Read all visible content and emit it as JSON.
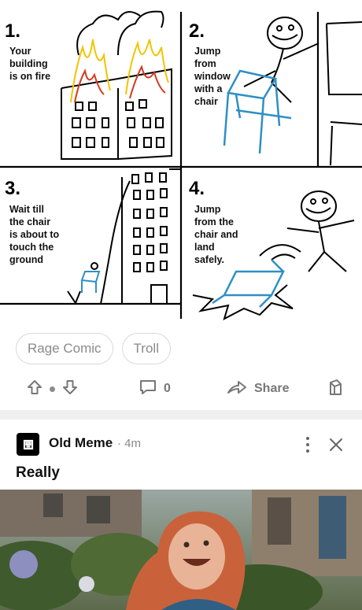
{
  "comic": {
    "panels": [
      {
        "number": "1.",
        "text": "Your\nbuilding\nis on fire"
      },
      {
        "number": "2.",
        "text": "Jump\nfrom\nwindow\nwith a\nchair"
      },
      {
        "number": "3.",
        "text": "Wait till\nthe chair\nis about to\ntouch the\nground"
      },
      {
        "number": "4.",
        "text": "Jump\nfrom the\nchair and\nland\nsafely."
      }
    ]
  },
  "tags": [
    "Rage Comic",
    "Troll"
  ],
  "actions": {
    "upvote_icon": "arrow-up-icon",
    "downvote_icon": "arrow-down-icon",
    "comment_count": "0",
    "share_label": "Share",
    "save_icon": "bookmark-icon"
  },
  "next_post": {
    "section_name": "Old Meme",
    "time": "· 4m",
    "title": "Really"
  },
  "colors": {
    "accent": "#000000",
    "muted": "#8a8a8a",
    "separator": "#efefef",
    "chair_blue": "#2f8fc4"
  }
}
